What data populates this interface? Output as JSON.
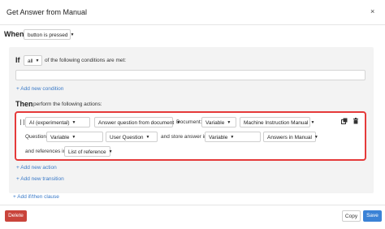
{
  "dialog": {
    "title": "Get Answer from Manual",
    "close_glyph": "×"
  },
  "when": {
    "label": "When",
    "trigger": "button is pressed"
  },
  "if_clause": {
    "label": "If",
    "quantifier": "all",
    "suffix": "of the following conditions are met:",
    "add_condition": "+ Add new condition"
  },
  "then_clause": {
    "label": "Then",
    "suffix": "perform the following actions:",
    "action": {
      "type": "AI (experimental)",
      "operation": "Answer question from document",
      "document_label": "Document:",
      "document_source": "Variable",
      "document_value": "Machine Instruction Manual",
      "question_label": "Question:",
      "question_source": "Variable",
      "question_value": "User Question",
      "store_label": "and store answer in:",
      "store_source": "Variable",
      "store_value": "Answers in Manual",
      "references_label": "and references in:",
      "references_value": "List of reference"
    },
    "add_action": "+ Add new action",
    "add_transition": "+ Add new transition"
  },
  "add_if_then": "+ Add if/then clause",
  "footer": {
    "delete": "Delete",
    "copy": "Copy",
    "save": "Save"
  },
  "colors": {
    "accent": "#3b82d6",
    "danger": "#c9443b",
    "highlight_border": "#e53a3a",
    "link": "#3a7ac8"
  },
  "icons": {
    "copy": "copy-icon",
    "delete": "trash-icon",
    "drag": "drag-handle-icon",
    "dropdown": "caret-down-icon"
  }
}
